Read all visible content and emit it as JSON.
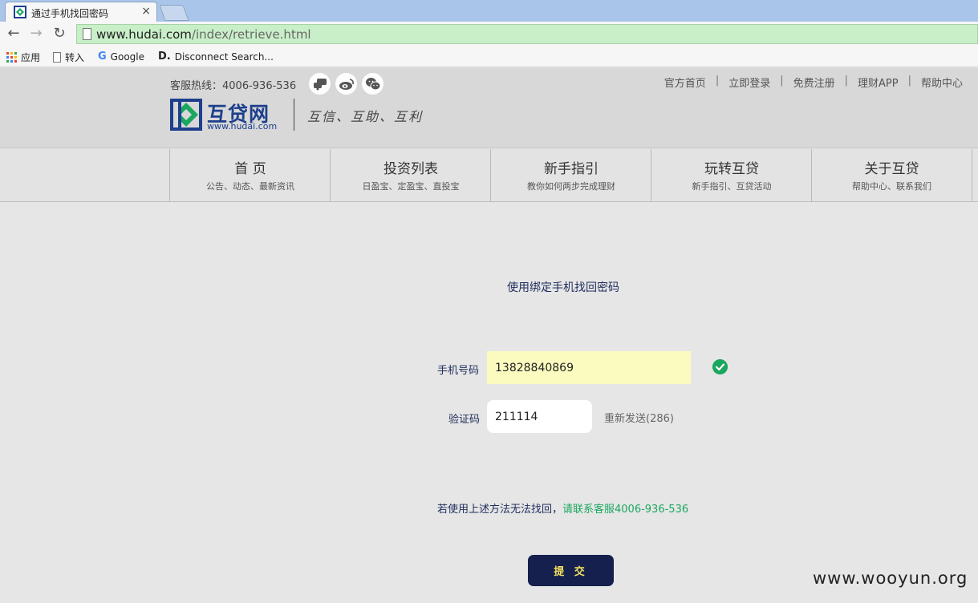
{
  "browser": {
    "tab_title": "通过手机找回密码",
    "tab_close": "×",
    "url_domain": "www.hudai.com",
    "url_path": "/index/retrieve.html",
    "bookmarks": [
      {
        "label": "应用",
        "icon": "apps-grid-icon"
      },
      {
        "label": "转入",
        "icon": "page-icon"
      },
      {
        "label": "Google",
        "icon": "google-icon"
      },
      {
        "label": "Disconnect Search...",
        "icon": "disconnect-icon"
      }
    ]
  },
  "header": {
    "hotline": "客服热线：4006-936-536",
    "social_icons": [
      "chat-icon",
      "weibo-icon",
      "wechat-icon"
    ],
    "top_links": [
      "官方首页",
      "立即登录",
      "免费注册",
      "理财APP",
      "帮助中心"
    ],
    "separator": "|",
    "logo_text": "互贷网",
    "logo_url": "www.hudai.com",
    "slogan": "互信、互助、互利"
  },
  "nav": [
    {
      "title": "首 页",
      "sub": "公告、动态、最新资讯"
    },
    {
      "title": "投资列表",
      "sub": "日盈宝、定盈宝、直投宝"
    },
    {
      "title": "新手指引",
      "sub": "教你如何两步完成理财"
    },
    {
      "title": "玩转互贷",
      "sub": "新手指引、互贷活动"
    },
    {
      "title": "关于互贷",
      "sub": "帮助中心、联系我们"
    }
  ],
  "form": {
    "title": "使用绑定手机找回密码",
    "phone_label": "手机号码",
    "phone_value": "13828840869",
    "code_label": "验证码",
    "code_value": "211114",
    "resend": "重新发送(286)",
    "help_text": "若使用上述方法无法找回，",
    "help_link": "请联系客服4006-936-536",
    "submit": "提 交"
  },
  "watermark": "www.wooyun.org",
  "colors": {
    "brand_blue": "#1d3f8c",
    "brand_green": "#1aa75f",
    "button_bg": "#15204e",
    "button_text": "#f2e05e"
  }
}
